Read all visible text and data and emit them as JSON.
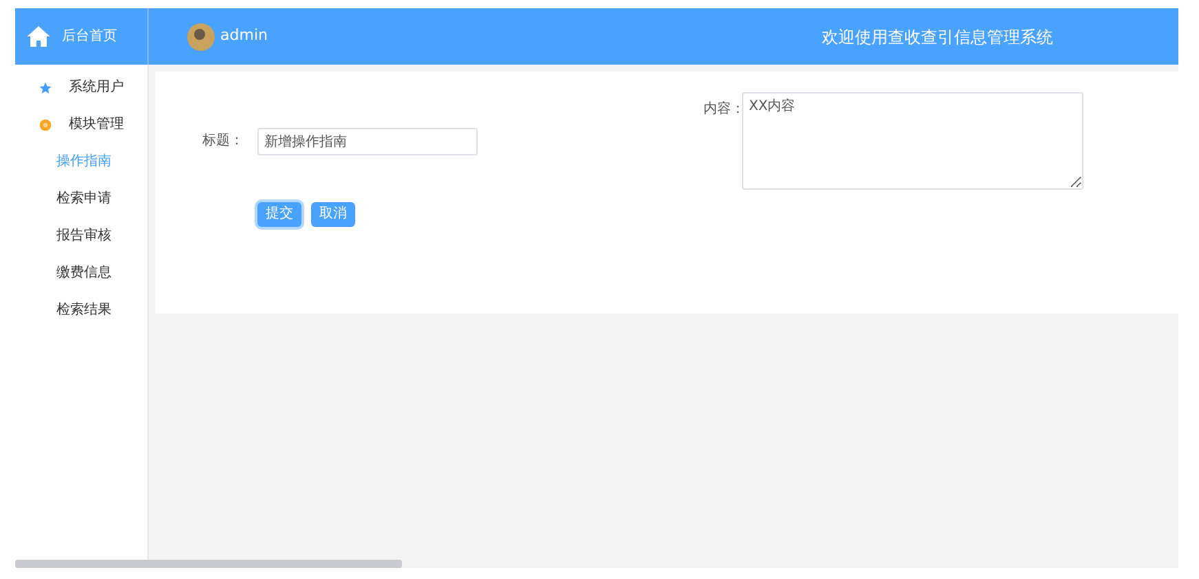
{
  "header": {
    "home": "后台首页",
    "user": "admin",
    "welcome": "欢迎使用查收查引信息管理系统"
  },
  "sidebar": {
    "items": [
      {
        "label": "系统用户",
        "kind": "star",
        "selected": false
      },
      {
        "label": "模块管理",
        "kind": "gear",
        "selected": false,
        "children": [
          {
            "label": "操作指南",
            "selected": true
          },
          {
            "label": "检索申请",
            "selected": false
          },
          {
            "label": "报告审核",
            "selected": false
          },
          {
            "label": "缴费信息",
            "selected": false
          },
          {
            "label": "检索结果",
            "selected": false
          }
        ]
      }
    ]
  },
  "form": {
    "title_label": "标题：",
    "title_value": "新增操作指南",
    "content_label": "内容：",
    "content_value": "XX内容",
    "buttons": [
      {
        "label": "提交",
        "focused": true
      },
      {
        "label": "取消",
        "focused": false
      }
    ]
  }
}
